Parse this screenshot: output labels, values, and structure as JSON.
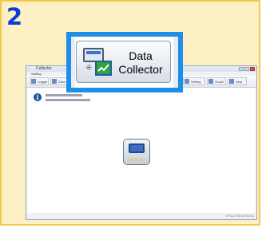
{
  "step": {
    "number": "2"
  },
  "callout": {
    "button_label_line1": "Data",
    "button_label_line2": "Collector",
    "button_icon": "data-collector-icon"
  },
  "window": {
    "title": "Collector",
    "menu": "Setting",
    "toolbar_labels": [
      "Logger",
      "Data",
      "Collector",
      "Setting",
      "Graph",
      "Help"
    ],
    "status_text": "EYL17-03-19 01:01"
  },
  "colors": {
    "panel_background": "#fdf0c4",
    "panel_border": "#f4c84a",
    "step_number": "#0d3ed4",
    "callout_border": "#1e8fe8"
  }
}
